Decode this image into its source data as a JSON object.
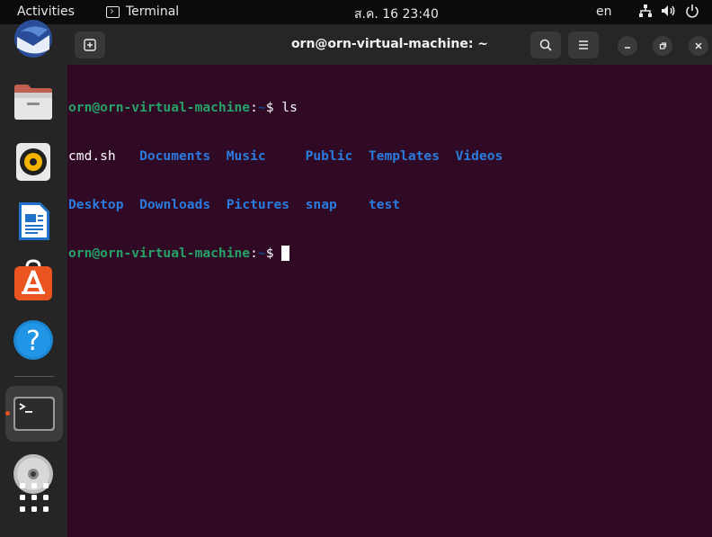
{
  "topbar": {
    "activities": "Activities",
    "app_name": "Terminal",
    "clock": "ส.ค. 16  23:40",
    "lang": "en",
    "icons": [
      "network-icon",
      "volume-icon",
      "power-icon"
    ]
  },
  "dock": {
    "items": [
      "thunderbird-icon",
      "files-icon",
      "rhythmbox-icon",
      "libreoffice-writer-icon",
      "software-center-icon",
      "help-icon",
      "terminal-icon",
      "dvd-icon",
      "show-apps-icon"
    ],
    "active": "terminal"
  },
  "terminal": {
    "title": "orn@orn-virtual-machine: ~",
    "prompt_user": "orn@orn-virtual-machine",
    "prompt_sep": ":",
    "prompt_path": "~",
    "prompt_symbol": "$",
    "command": "ls",
    "ls_row1": [
      "cmd.sh",
      "Documents",
      "Music",
      "Public",
      "Templates",
      "Videos"
    ],
    "ls_row2": [
      "Desktop",
      "Downloads",
      "Pictures",
      "snap",
      "test"
    ]
  },
  "colors": {
    "terminal_bg": "#300a24",
    "prompt_user": "#26a269",
    "prompt_path": "#12488b",
    "directory": "#2a7bde",
    "accent": "#e95420"
  }
}
